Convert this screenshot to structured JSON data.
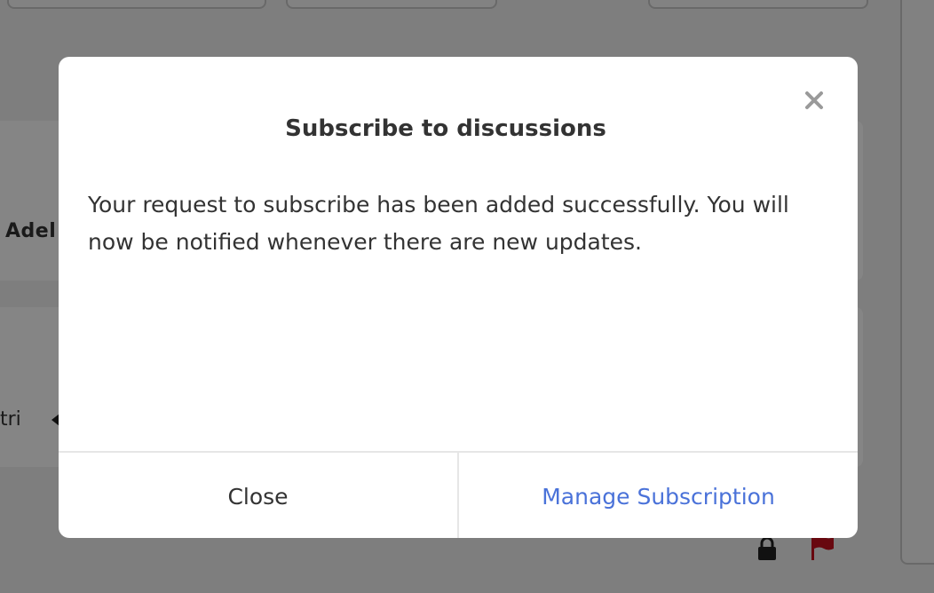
{
  "background": {
    "author_name_partial": "Adel",
    "snippet_partial": "tri",
    "icons": {
      "lock": "lock-icon",
      "flag": "flag-icon"
    },
    "colors": {
      "flag": "#c8101d",
      "lock": "#222222"
    }
  },
  "modal": {
    "title": "Subscribe to discussions",
    "message": "Your request to subscribe has been added successfully. You will now be notified whenever there are new updates.",
    "close_icon": "close-icon",
    "buttons": {
      "close_label": "Close",
      "manage_label": "Manage Subscription"
    },
    "colors": {
      "primary_link": "#4a72d9",
      "text": "#333333"
    }
  }
}
